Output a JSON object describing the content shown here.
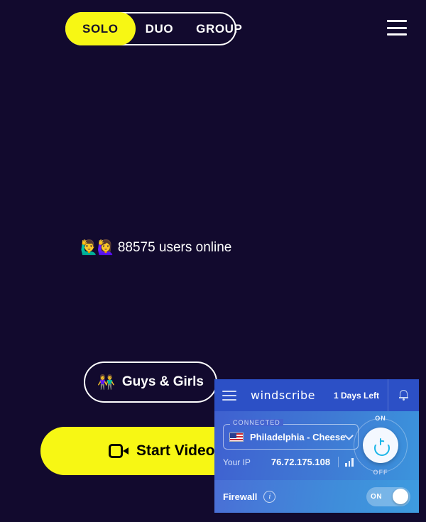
{
  "page": {
    "background_color": "#120a2e",
    "accent_color": "#f7f714"
  },
  "top_bar": {
    "modes": [
      {
        "label": "SOLO",
        "active": true
      },
      {
        "label": "DUO",
        "active": false
      },
      {
        "label": "GROUP",
        "active": false
      }
    ],
    "menu_icon": "hamburger-menu-icon"
  },
  "main": {
    "users_online": {
      "emoji": "🙋‍♂️🙋‍♀️",
      "text": "88575 users online",
      "count": 88575
    },
    "filter_button": {
      "emoji": "👫",
      "label": "Guys & Girls"
    },
    "cta_button": {
      "label": "Start Video Chat",
      "icon": "video-camera-icon",
      "background": "#f7f714",
      "text_color": "#000000"
    }
  },
  "vpn_panel": {
    "header": {
      "menu_icon": "hamburger-menu-icon",
      "logo": "windscribe",
      "days_left": "1 Days Left",
      "bell_icon": "notification-bell-icon",
      "background": "#2c50c6"
    },
    "connection": {
      "status_label": "CONNECTED",
      "flag": "us-flag-icon",
      "location": "Philadelphia - Cheese",
      "chevron": "chevron-down-icon"
    },
    "ip": {
      "label": "Your IP",
      "value": "76.72.175.108",
      "signal_icon": "signal-bars-icon"
    },
    "power": {
      "on_label": "ON",
      "off_label": "OFF",
      "state": "on",
      "glyph_color": "#19b5e8"
    },
    "firewall": {
      "label": "Firewall",
      "info_icon": "info-icon",
      "toggle_label": "ON",
      "toggle_state": "on"
    }
  }
}
